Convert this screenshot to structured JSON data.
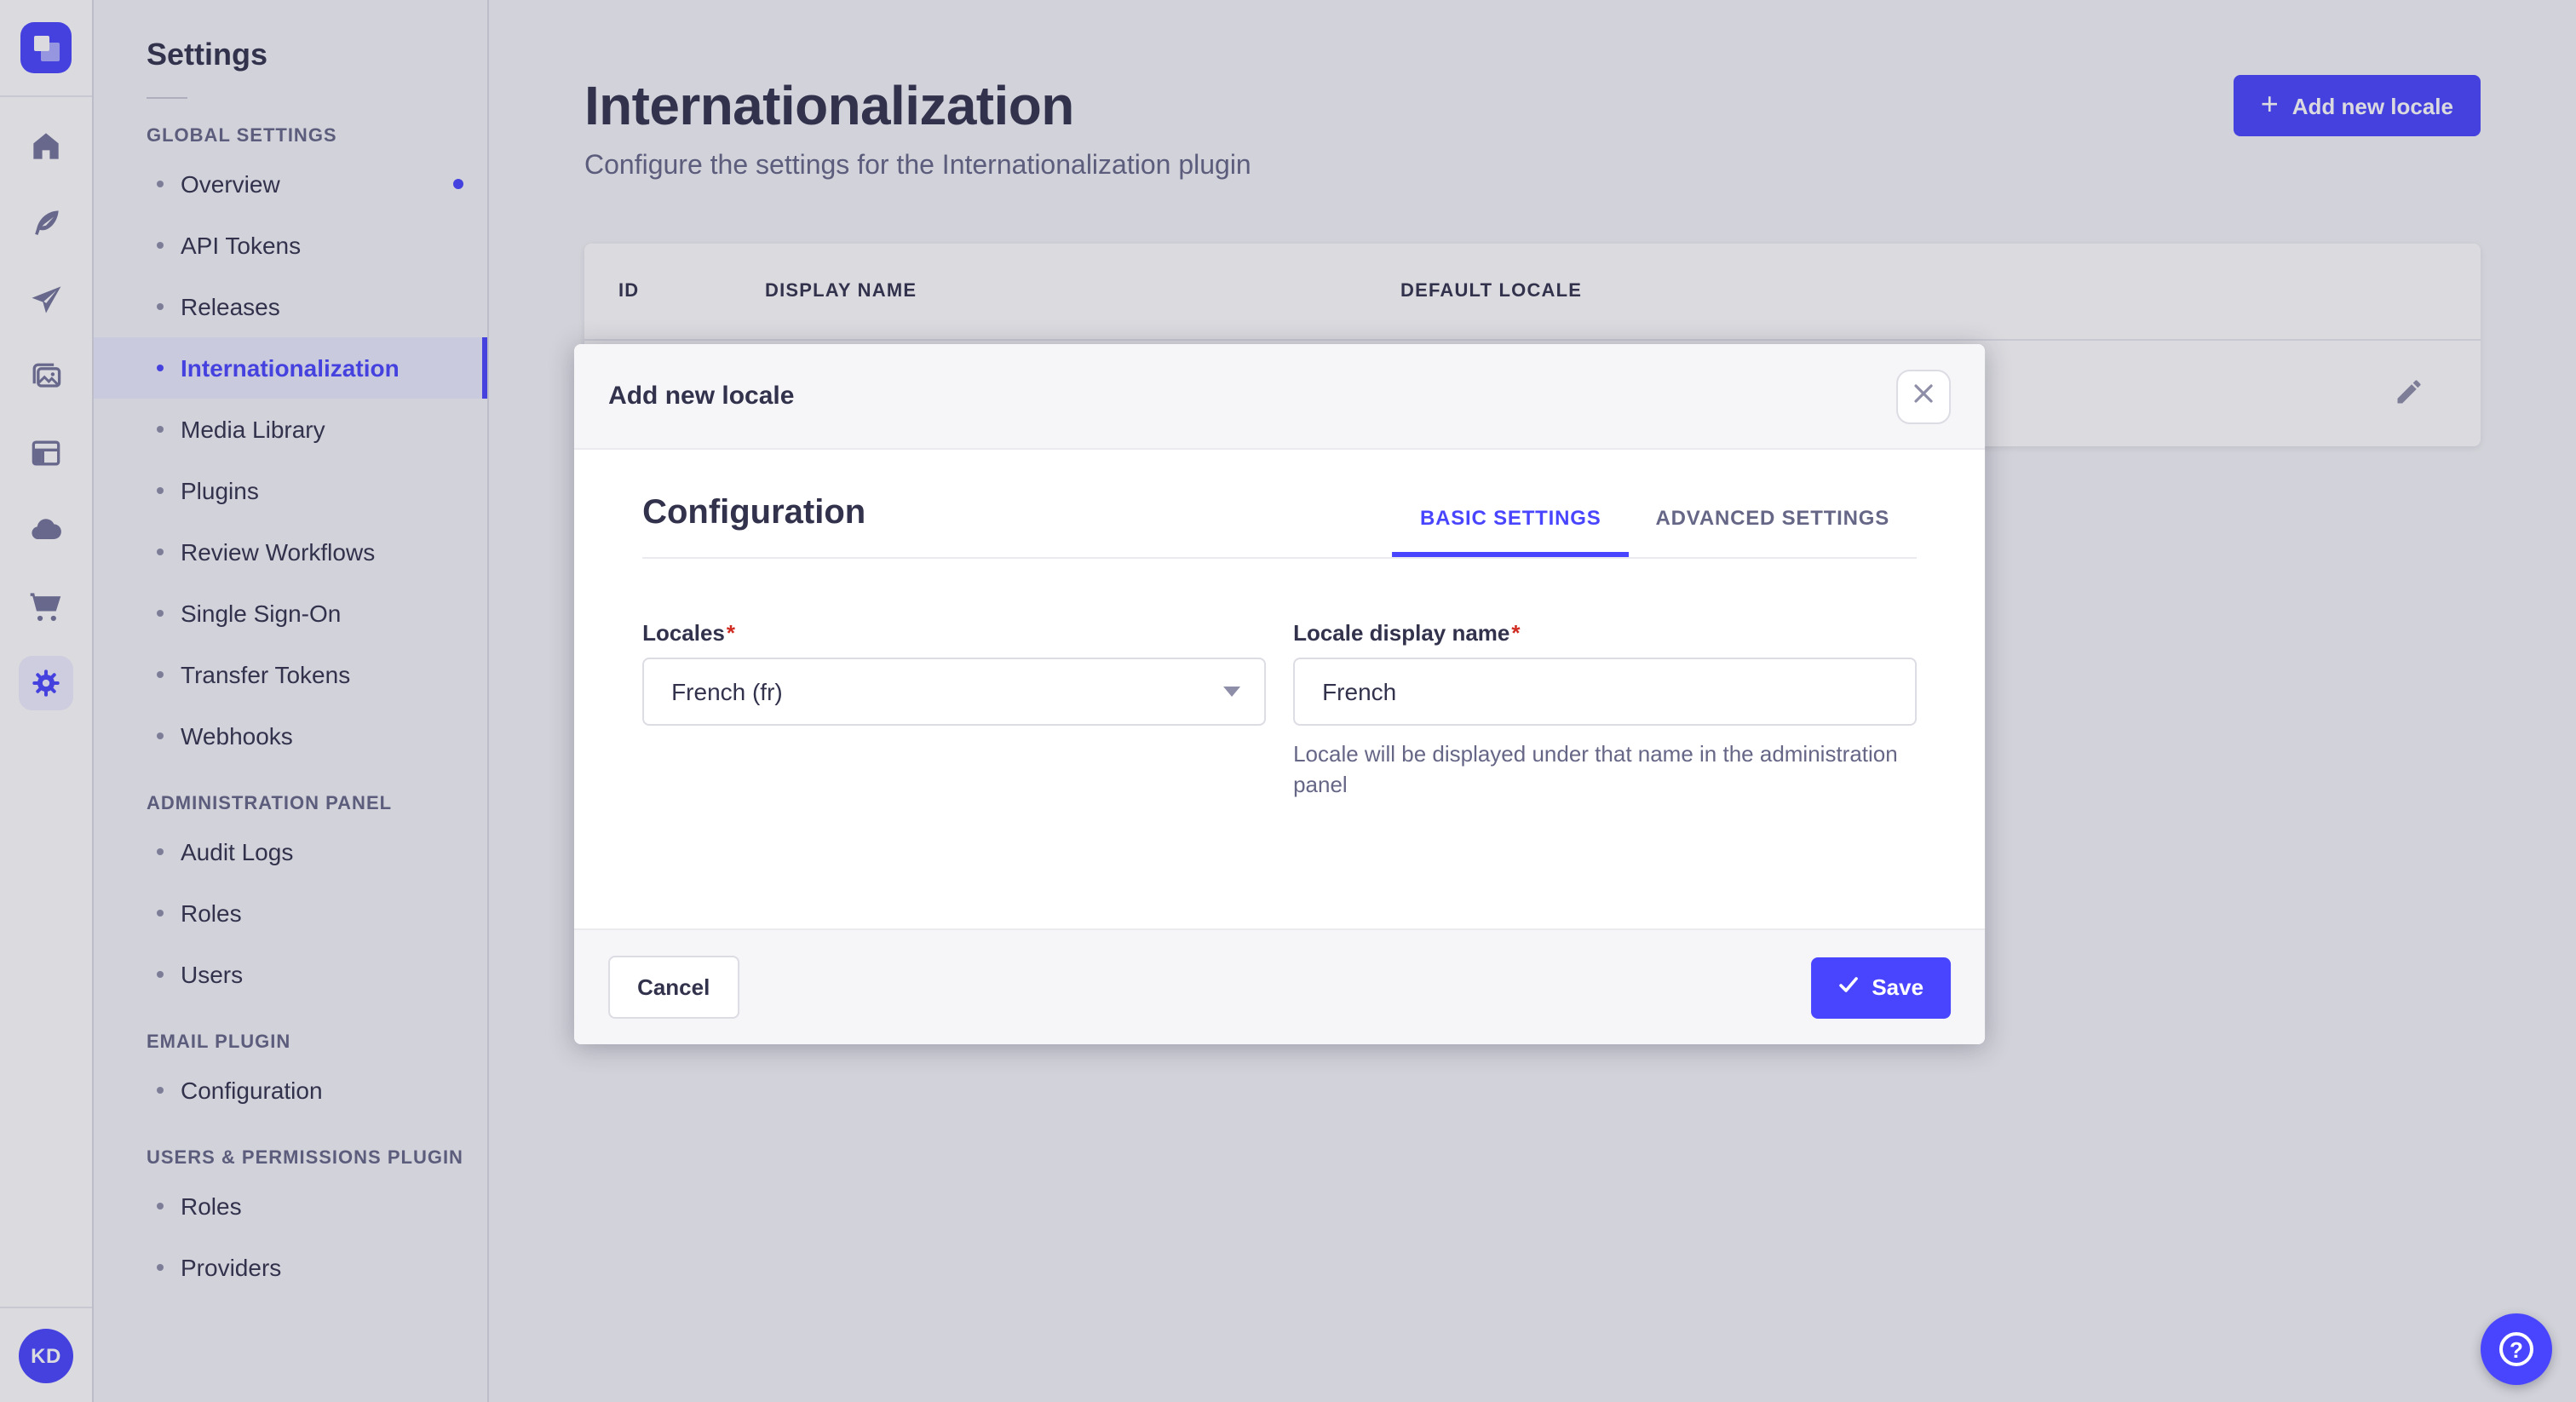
{
  "colors": {
    "accent": "#4945ff",
    "text_dark": "#32324d",
    "text_muted": "#666687",
    "required_asterisk": "#d02b20",
    "active_item_bg": "#ececff"
  },
  "rail": {
    "logo_icon": "strapi-logo",
    "icons": [
      "home-icon",
      "feather-icon",
      "paper-plane-icon",
      "media-icon",
      "layout-icon",
      "cloud-icon",
      "cart-icon",
      "gear-icon"
    ],
    "active_icon": "gear-icon",
    "avatar_initials": "KD"
  },
  "sidebar": {
    "title": "Settings",
    "sections": [
      {
        "label": "GLOBAL SETTINGS",
        "items": [
          {
            "label": "Overview",
            "has_notification": true
          },
          {
            "label": "API Tokens"
          },
          {
            "label": "Releases"
          },
          {
            "label": "Internationalization",
            "active": true
          },
          {
            "label": "Media Library"
          },
          {
            "label": "Plugins"
          },
          {
            "label": "Review Workflows"
          },
          {
            "label": "Single Sign-On"
          },
          {
            "label": "Transfer Tokens"
          },
          {
            "label": "Webhooks"
          }
        ]
      },
      {
        "label": "ADMINISTRATION PANEL",
        "items": [
          {
            "label": "Audit Logs"
          },
          {
            "label": "Roles"
          },
          {
            "label": "Users"
          }
        ]
      },
      {
        "label": "EMAIL PLUGIN",
        "items": [
          {
            "label": "Configuration"
          }
        ]
      },
      {
        "label": "USERS & PERMISSIONS PLUGIN",
        "items": [
          {
            "label": "Roles"
          },
          {
            "label": "Providers"
          }
        ]
      }
    ]
  },
  "header": {
    "title": "Internationalization",
    "subtitle": "Configure the settings for the Internationalization plugin",
    "add_button_label": "Add new locale",
    "add_button_icon": "plus-icon"
  },
  "table": {
    "columns": [
      "ID",
      "DISPLAY NAME",
      "DEFAULT LOCALE"
    ],
    "row_action_icon": "edit-pencil-icon"
  },
  "modal": {
    "title": "Add new locale",
    "close_icon": "close-x-icon",
    "section_title": "Configuration",
    "tabs": [
      {
        "label": "BASIC SETTINGS",
        "active": true
      },
      {
        "label": "ADVANCED SETTINGS",
        "active": false
      }
    ],
    "fields": {
      "locales": {
        "label": "Locales",
        "required": "*",
        "value": "French (fr)",
        "caret_icon": "chevron-down-icon"
      },
      "display_name": {
        "label": "Locale display name",
        "required": "*",
        "value": "French",
        "hint": "Locale will be displayed under that name in the administration panel"
      }
    },
    "cancel_label": "Cancel",
    "save_label": "Save",
    "save_icon": "check-icon"
  },
  "help": {
    "icon": "question-mark-icon",
    "glyph": "?"
  }
}
